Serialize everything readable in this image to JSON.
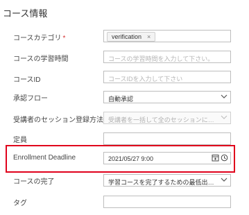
{
  "page": {
    "title": "コース情報"
  },
  "fields": {
    "category": {
      "label": "コースカテゴリ",
      "required_mark": "*",
      "chip": "verification",
      "chip_remove": "×"
    },
    "study_time": {
      "label": "コースの学習時間",
      "placeholder": "コースの学習時間を入力して下さい。"
    },
    "course_id": {
      "label": "コースID",
      "placeholder": "コースIDを入力して下さい"
    },
    "approval_flow": {
      "label": "承認フロー",
      "value": "自動承認"
    },
    "session_registration": {
      "label": "受講者のセッション登録方法",
      "value": "受講者を一括して全のセッションに登録..."
    },
    "price": {
      "label": "定員",
      "value": ""
    },
    "enrollment_deadline": {
      "label": "Enrollment Deadline",
      "value": "2021/05/27 9:00"
    },
    "completion": {
      "label": "コースの完了",
      "value": "学習コースを完了するための最低出席率..."
    },
    "tag": {
      "label": "タグ",
      "value": ""
    }
  },
  "colors": {
    "highlight": "#e0001b",
    "required": "#d32f2f",
    "border": "#bdbdbd"
  }
}
